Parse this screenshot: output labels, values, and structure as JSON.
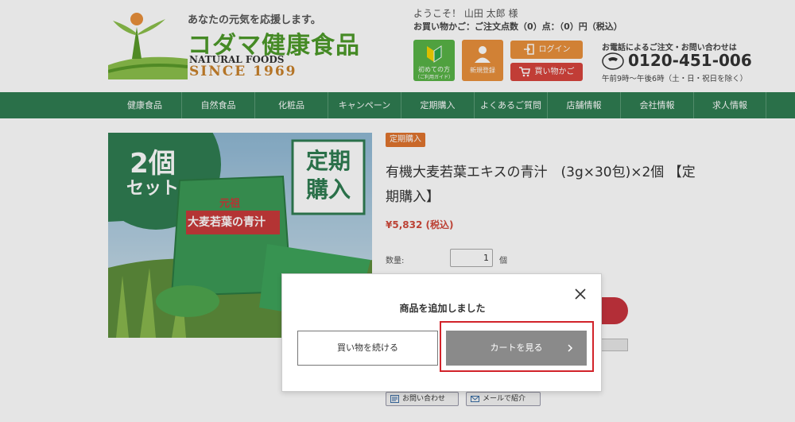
{
  "header": {
    "tagline": "あなたの元気を応援します。",
    "brand_name": "コダマ健康食品",
    "brand_en": "NATURAL FOODS",
    "brand_since": "SINCE 1969",
    "welcome": "ようこそ！ 山田 太郎 様",
    "cart_info": "お買い物かご：ご注文点数（0）点：（0）円（税込）",
    "guide_label_1": "初めての方",
    "guide_label_2": "（ご利用ガイド）",
    "register_label": "新規登録",
    "login_label": "ログイン",
    "cart_label": "買い物かご",
    "tel_title": "お電話によるご注文・お問い合わせは",
    "tel_number": "0120-451-006",
    "tel_hours": "午前9時〜午後6時（土・日・祝日を除く）",
    "colors": {
      "guide": "#58b447",
      "orange": "#e9903b",
      "red": "#d7453d"
    }
  },
  "nav": {
    "items": [
      "健康食品",
      "自然食品",
      "化粧品",
      "キャンペーン",
      "定期購入",
      "よくあるご質問",
      "店舗情報",
      "会社情報",
      "求人情報"
    ],
    "color": "#2f7d52"
  },
  "product": {
    "image_set_label_1": "2個",
    "image_set_label_2": "セット",
    "image_teiki_1": "定期",
    "image_teiki_2": "購入",
    "image_pack_text": "大麦若葉の青汁",
    "image_pack_top": "元祖",
    "badge": "定期購入",
    "title": "有機大麦若葉エキスの青汁　(3g×30包)×2個 【定期購入】",
    "price": "¥5,832 (税込)",
    "qty_label": "数量:",
    "qty_value": "1",
    "qty_unit": "個",
    "contact_btn": "お問い合わせ",
    "mail_btn": "メールで紹介"
  },
  "modal": {
    "title": "商品を追加しました",
    "continue_label": "買い物を続ける",
    "view_cart_label": "カートを見る"
  }
}
